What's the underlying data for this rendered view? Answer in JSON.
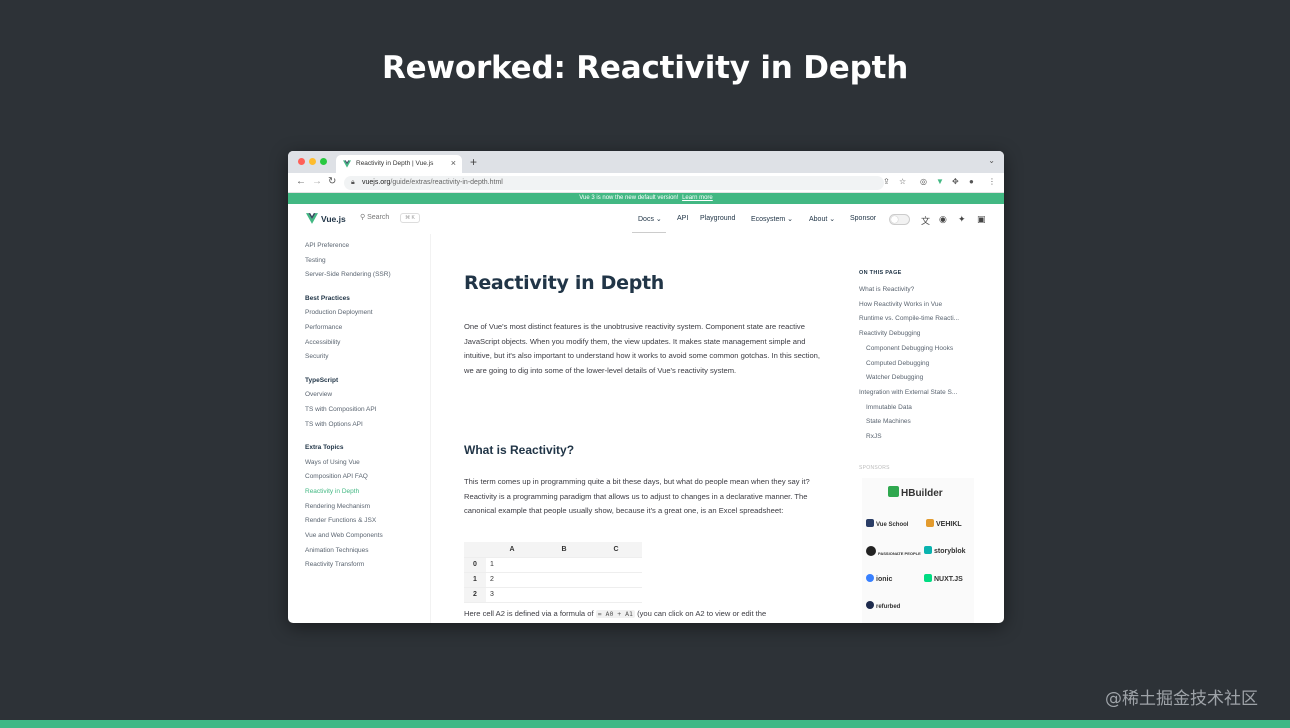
{
  "slide": {
    "title": "Reworked: Reactivity in Depth",
    "watermark": "@稀土掘金技术社区"
  },
  "browser": {
    "tab_title": "Reactivity in Depth | Vue.js",
    "tab_close": "×",
    "new_tab": "+",
    "tab_list": "⌄",
    "url_domain": "vuejs.org",
    "url_path": "/guide/extras/reactivity-in-depth.html"
  },
  "banner": {
    "text": "Vue 3 is now the new default version!",
    "link": "Learn more"
  },
  "vue_nav": {
    "brand": "Vue.js",
    "search_label": "Search",
    "search_shortcut": "⌘ K",
    "links": [
      "Docs ⌄",
      "API",
      "Playground",
      "Ecosystem ⌄",
      "About ⌄",
      "Sponsor"
    ]
  },
  "sidebar": {
    "top_items": [
      "API Preference",
      "Testing",
      "Server-Side Rendering (SSR)"
    ],
    "sections": [
      {
        "heading": "Best Practices",
        "items": [
          "Production Deployment",
          "Performance",
          "Accessibility",
          "Security"
        ]
      },
      {
        "heading": "TypeScript",
        "items": [
          "Overview",
          "TS with Composition API",
          "TS with Options API"
        ]
      },
      {
        "heading": "Extra Topics",
        "items": [
          "Ways of Using Vue",
          "Composition API FAQ",
          "Reactivity in Depth",
          "Rendering Mechanism",
          "Render Functions & JSX",
          "Vue and Web Components",
          "Animation Techniques",
          "Reactivity Transform"
        ]
      }
    ]
  },
  "content": {
    "title": "Reactivity in Depth",
    "intro": "One of Vue's most distinct features is the unobtrusive reactivity system. Component state are reactive JavaScript objects. When you modify them, the view updates. It makes state management simple and intuitive, but it's also important to understand how it works to avoid some common gotchas. In this section, we are going to dig into some of the lower-level details of Vue's reactivity system.",
    "section_title": "What is Reactivity?",
    "section_para": "This term comes up in programming quite a bit these days, but what do people mean when they say it? Reactivity is a programming paradigm that allows us to adjust to changes in a declarative manner. The canonical example that people usually show, because it's a great one, is an Excel spreadsheet:",
    "sheet": {
      "columns": [
        "A",
        "B",
        "C"
      ],
      "rows": [
        {
          "index": "0",
          "a": "1"
        },
        {
          "index": "1",
          "a": "2"
        },
        {
          "index": "2",
          "a": "3"
        }
      ]
    },
    "after_sheet_start": "Here cell A2 is defined via a formula of",
    "after_sheet_code": "= A0 + A1",
    "after_sheet_end": "(you can click on A2 to view or edit the"
  },
  "toc": {
    "heading": "ON THIS PAGE",
    "items": [
      {
        "label": "What is Reactivity?",
        "indent": false
      },
      {
        "label": "How Reactivity Works in Vue",
        "indent": false
      },
      {
        "label": "Runtime vs. Compile-time Reacti...",
        "indent": false
      },
      {
        "label": "Reactivity Debugging",
        "indent": false
      },
      {
        "label": "Component Debugging Hooks",
        "indent": true
      },
      {
        "label": "Computed Debugging",
        "indent": true
      },
      {
        "label": "Watcher Debugging",
        "indent": true
      },
      {
        "label": "Integration with External State S...",
        "indent": false
      },
      {
        "label": "Immutable Data",
        "indent": true
      },
      {
        "label": "State Machines",
        "indent": true
      },
      {
        "label": "RxJS",
        "indent": true
      }
    ],
    "sponsors_heading": "SPONSORS",
    "sponsors": [
      "HBuilder",
      "Vue School",
      "VEHIKL",
      "PASSIONATE PEOPLE",
      "storyblok",
      "ionic",
      "NUXT.JS",
      "refurbed"
    ]
  },
  "colors": {
    "vue_green": "#42b883",
    "slide_bg": "#2d3237"
  }
}
